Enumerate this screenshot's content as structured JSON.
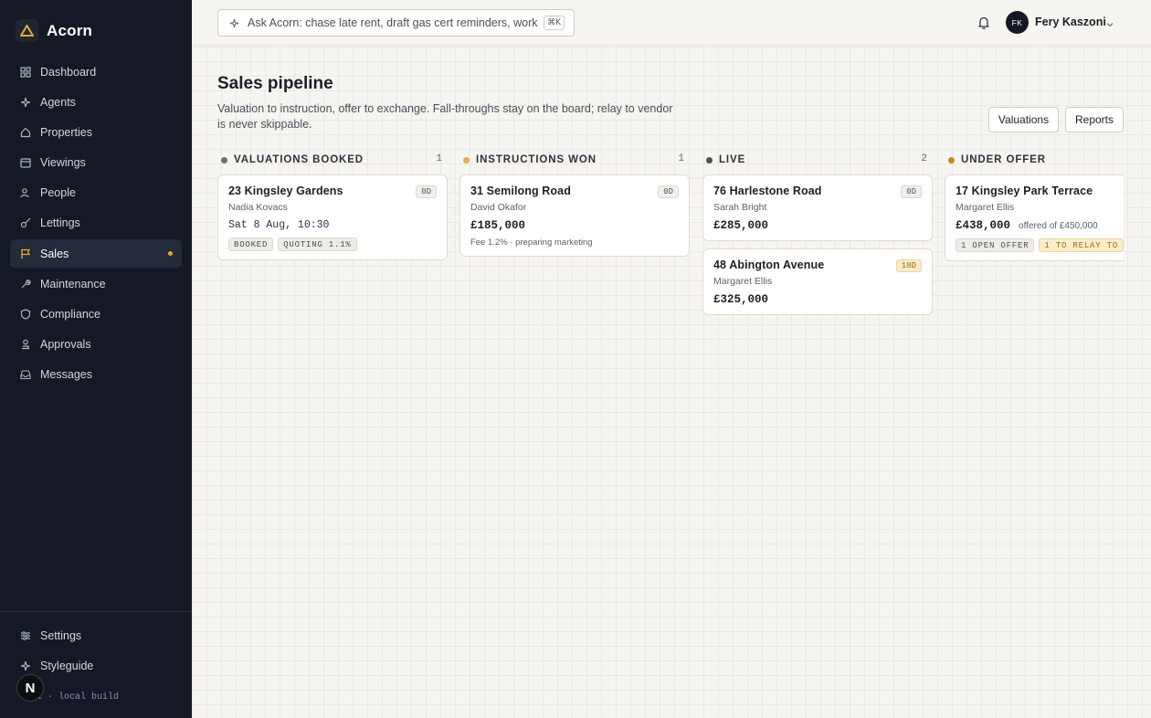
{
  "app": {
    "name": "Acorn",
    "build": "v0.1 · local build",
    "corner_badge": "N"
  },
  "sidebar": {
    "items": [
      {
        "label": "Dashboard",
        "icon": "grid-icon"
      },
      {
        "label": "Agents",
        "icon": "sparkle-icon"
      },
      {
        "label": "Properties",
        "icon": "home-icon"
      },
      {
        "label": "Viewings",
        "icon": "calendar-icon"
      },
      {
        "label": "People",
        "icon": "users-icon"
      },
      {
        "label": "Lettings",
        "icon": "key-icon"
      },
      {
        "label": "Sales",
        "icon": "flag-icon",
        "active": true
      },
      {
        "label": "Maintenance",
        "icon": "wrench-icon"
      },
      {
        "label": "Compliance",
        "icon": "shield-icon"
      },
      {
        "label": "Approvals",
        "icon": "stamp-icon"
      },
      {
        "label": "Messages",
        "icon": "inbox-icon"
      }
    ],
    "bottom": [
      {
        "label": "Settings",
        "icon": "sliders-icon"
      },
      {
        "label": "Styleguide",
        "icon": "sparkle-icon"
      }
    ]
  },
  "topbar": {
    "search_text": "Ask Acorn: chase late rent, draft gas cert reminders, work th",
    "shortcut": "⌘K",
    "user_initials": "FK",
    "user_name": "Fery Kaszoni"
  },
  "page": {
    "title": "Sales pipeline",
    "description": "Valuation to instruction, offer to exchange. Fall-throughs stay on the board; relay to vendor is never skippable.",
    "buttons": {
      "valuations": "Valuations",
      "reports": "Reports"
    }
  },
  "colors": {
    "accent": "#e8a92b",
    "sidebar_bg": "#141925",
    "warn_bg": "#fbeccb"
  },
  "columns": [
    {
      "title": "VALUATIONS BOOKED",
      "count": "1",
      "dot_color": "#6b6f78",
      "cards": [
        {
          "title": "23 Kingsley Gardens",
          "age": "0D",
          "person": "Nadia Kovacs",
          "when": "Sat 8 Aug, 10:30",
          "tags": [
            "BOOKED",
            "QUOTING 1.1%"
          ]
        }
      ]
    },
    {
      "title": "INSTRUCTIONS WON",
      "count": "1",
      "dot_color": "#e0b04a",
      "cards": [
        {
          "title": "31 Semilong Road",
          "age": "0D",
          "person": "David Okafor",
          "price": "£185,000",
          "note": "Fee 1.2% · preparing marketing"
        }
      ]
    },
    {
      "title": "LIVE",
      "count": "2",
      "dot_color": "#4b4f58",
      "cards": [
        {
          "title": "76 Harlestone Road",
          "age": "0D",
          "person": "Sarah Bright",
          "price": "£285,000"
        },
        {
          "title": "48 Abington Avenue",
          "age": "18D",
          "age_warn": true,
          "person": "Margaret Ellis",
          "price": "£325,000"
        }
      ]
    },
    {
      "title": "UNDER OFFER",
      "count": "",
      "dot_color": "#c48a1c",
      "cards": [
        {
          "title": "17 Kingsley Park Terrace",
          "person": "Margaret Ellis",
          "price": "£438,000",
          "offered": "offered of £450,000",
          "tags": [
            "1 OPEN OFFER",
            "1 TO RELAY TO"
          ]
        }
      ]
    }
  ]
}
